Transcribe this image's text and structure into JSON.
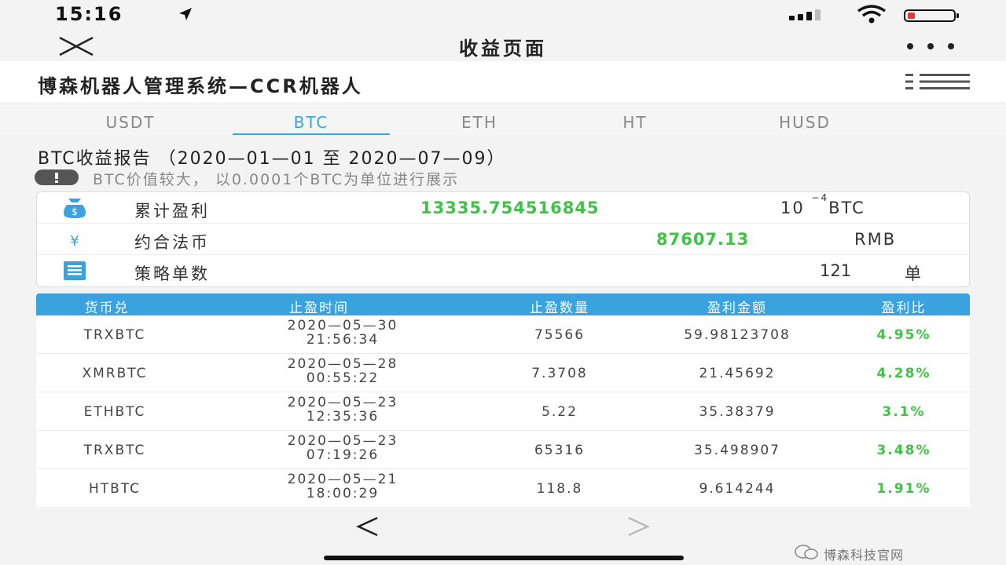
{
  "status_bar": {
    "time": "15:16"
  },
  "nav": {
    "title": "收益页面"
  },
  "app": {
    "title": "博森机器人管理系统—CCR机器人"
  },
  "tabs": [
    {
      "label": "USDT",
      "active": false
    },
    {
      "label": "BTC",
      "active": true
    },
    {
      "label": "ETH",
      "active": false
    },
    {
      "label": "HT",
      "active": false
    },
    {
      "label": "HUSD",
      "active": false
    }
  ],
  "report": {
    "title": "BTC收益报告  （2020—01—01 至 2020—07—09）",
    "notice": "BTC价值较大， 以0.0001个BTC为单位进行展示"
  },
  "summary": {
    "profit_label": "累计盈利",
    "profit_value": "13335.754516845",
    "profit_unit_base": "10",
    "profit_unit_exp": "−4",
    "profit_unit_suffix": "BTC",
    "fiat_label": "约合法币",
    "fiat_value": "87607.13",
    "fiat_unit": "RMB",
    "orders_label": "策略单数",
    "orders_value": "121",
    "orders_unit": "单"
  },
  "table": {
    "headers": [
      "货币兑",
      "止盈时间",
      "止盈数量",
      "盈利金额",
      "盈利比"
    ],
    "rows": [
      {
        "pair": "TRXBTC",
        "date": "2020—05—30",
        "time": "21:56:34",
        "qty": "75566",
        "amount": "59.98123708",
        "ratio": "4.95%"
      },
      {
        "pair": "XMRBTC",
        "date": "2020—05—28",
        "time": "00:55:22",
        "qty": "7.3708",
        "amount": "21.45692",
        "ratio": "4.28%"
      },
      {
        "pair": "ETHBTC",
        "date": "2020—05—23",
        "time": "12:35:36",
        "qty": "5.22",
        "amount": "35.38379",
        "ratio": "3.1%"
      },
      {
        "pair": "TRXBTC",
        "date": "2020—05—23",
        "time": "07:19:26",
        "qty": "65316",
        "amount": "35.498907",
        "ratio": "3.48%"
      },
      {
        "pair": "HTBTC",
        "date": "2020—05—21",
        "time": "18:00:29",
        "qty": "118.8",
        "amount": "9.614244",
        "ratio": "1.91%"
      }
    ]
  },
  "bottom": {
    "back_glyph": "<",
    "forward_glyph": ">",
    "watermark": "博森科技官网"
  },
  "colors": {
    "accent": "#3aa3df",
    "positive": "#3fc345",
    "battery_low": "#e53935"
  },
  "icons": {
    "profit": "money-bag-icon",
    "fiat": "yen-icon",
    "orders": "document-list-icon"
  }
}
